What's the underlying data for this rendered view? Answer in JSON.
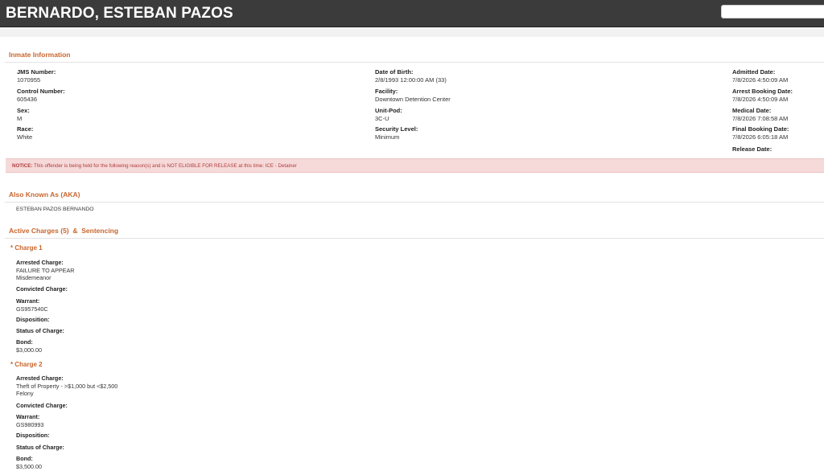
{
  "header": {
    "title": "BERNARDO, ESTEBAN PAZOS",
    "search_placeholder": ""
  },
  "inmate_info": {
    "section_title": "Inmate Information",
    "col1": [
      {
        "label": "JMS Number:",
        "value": "1070955"
      },
      {
        "label": "Control Number:",
        "value": "605436"
      },
      {
        "label": "Sex:",
        "value": "M"
      },
      {
        "label": "Race:",
        "value": "White"
      }
    ],
    "col2": [
      {
        "label": "Date of Birth:",
        "value": "2/8/1993 12:00:00 AM (33)"
      },
      {
        "label": "Facility:",
        "value": "Downtown Detention Center"
      },
      {
        "label": "Unit-Pod:",
        "value": "3C-U"
      },
      {
        "label": "Security Level:",
        "value": "Minimum"
      }
    ],
    "col3": [
      {
        "label": "Admitted Date:",
        "value": "7/8/2026 4:50:09 AM"
      },
      {
        "label": "Arrest Booking Date:",
        "value": "7/8/2026 4:50:09 AM"
      },
      {
        "label": "Medical Date:",
        "value": "7/8/2026 7:08:58 AM"
      },
      {
        "label": "Final Booking Date:",
        "value": "7/8/2026 6:05:18 AM"
      },
      {
        "label": "Release Date:",
        "value": ""
      }
    ]
  },
  "notice": {
    "prefix": "NOTICE:",
    "text": " This offender is being held for the following reason(s) and is NOT ELIGIBLE FOR RELEASE at this time: ICE - Detainer"
  },
  "aka": {
    "section_title": "Also Known As (AKA)",
    "names": [
      "ESTEBAN PAZOS BERNANDO"
    ]
  },
  "charges": {
    "title_left": "Active Charges (5)",
    "title_amp": "&",
    "title_right": "Sentencing",
    "items": [
      {
        "title": "* Charge 1",
        "arrested_label": "Arrested Charge:",
        "arrested_lines": [
          "FAILURE TO APPEAR",
          "Misdemeanor"
        ],
        "convicted_label": "Convicted Charge:",
        "warrant_label": "Warrant:",
        "warrant_value": "GS957540C",
        "disposition_label": "Disposition:",
        "status_label": "Status of Charge:",
        "bond_label": "Bond:",
        "bond_value": "$3,000.00"
      },
      {
        "title": "* Charge 2",
        "arrested_label": "Arrested Charge:",
        "arrested_lines": [
          "Theft of Property - >$1,000 but <$2,500",
          "Felony"
        ],
        "convicted_label": "Convicted Charge:",
        "warrant_label": "Warrant:",
        "warrant_value": "GS980993",
        "disposition_label": "Disposition:",
        "status_label": "Status of Charge:",
        "bond_label": "Bond:",
        "bond_value": "$3,500.00"
      }
    ]
  }
}
